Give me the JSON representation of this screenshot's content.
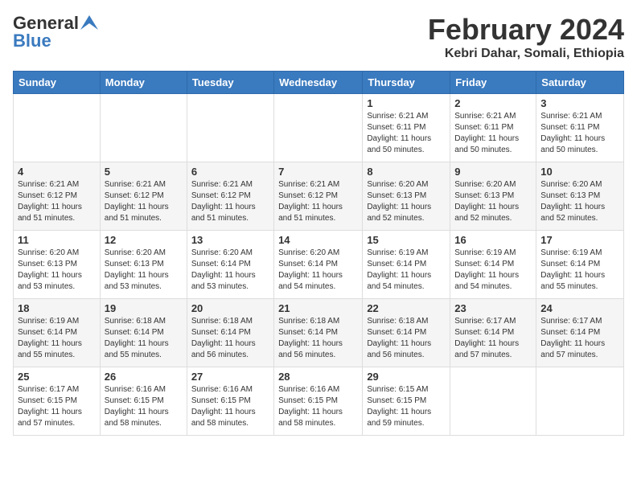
{
  "header": {
    "logo_general": "General",
    "logo_blue": "Blue",
    "month_title": "February 2024",
    "location": "Kebri Dahar, Somali, Ethiopia"
  },
  "weekdays": [
    "Sunday",
    "Monday",
    "Tuesday",
    "Wednesday",
    "Thursday",
    "Friday",
    "Saturday"
  ],
  "weeks": [
    [
      {
        "day": "",
        "info": ""
      },
      {
        "day": "",
        "info": ""
      },
      {
        "day": "",
        "info": ""
      },
      {
        "day": "",
        "info": ""
      },
      {
        "day": "1",
        "info": "Sunrise: 6:21 AM\nSunset: 6:11 PM\nDaylight: 11 hours\nand 50 minutes."
      },
      {
        "day": "2",
        "info": "Sunrise: 6:21 AM\nSunset: 6:11 PM\nDaylight: 11 hours\nand 50 minutes."
      },
      {
        "day": "3",
        "info": "Sunrise: 6:21 AM\nSunset: 6:11 PM\nDaylight: 11 hours\nand 50 minutes."
      }
    ],
    [
      {
        "day": "4",
        "info": "Sunrise: 6:21 AM\nSunset: 6:12 PM\nDaylight: 11 hours\nand 51 minutes."
      },
      {
        "day": "5",
        "info": "Sunrise: 6:21 AM\nSunset: 6:12 PM\nDaylight: 11 hours\nand 51 minutes."
      },
      {
        "day": "6",
        "info": "Sunrise: 6:21 AM\nSunset: 6:12 PM\nDaylight: 11 hours\nand 51 minutes."
      },
      {
        "day": "7",
        "info": "Sunrise: 6:21 AM\nSunset: 6:12 PM\nDaylight: 11 hours\nand 51 minutes."
      },
      {
        "day": "8",
        "info": "Sunrise: 6:20 AM\nSunset: 6:13 PM\nDaylight: 11 hours\nand 52 minutes."
      },
      {
        "day": "9",
        "info": "Sunrise: 6:20 AM\nSunset: 6:13 PM\nDaylight: 11 hours\nand 52 minutes."
      },
      {
        "day": "10",
        "info": "Sunrise: 6:20 AM\nSunset: 6:13 PM\nDaylight: 11 hours\nand 52 minutes."
      }
    ],
    [
      {
        "day": "11",
        "info": "Sunrise: 6:20 AM\nSunset: 6:13 PM\nDaylight: 11 hours\nand 53 minutes."
      },
      {
        "day": "12",
        "info": "Sunrise: 6:20 AM\nSunset: 6:13 PM\nDaylight: 11 hours\nand 53 minutes."
      },
      {
        "day": "13",
        "info": "Sunrise: 6:20 AM\nSunset: 6:14 PM\nDaylight: 11 hours\nand 53 minutes."
      },
      {
        "day": "14",
        "info": "Sunrise: 6:20 AM\nSunset: 6:14 PM\nDaylight: 11 hours\nand 54 minutes."
      },
      {
        "day": "15",
        "info": "Sunrise: 6:19 AM\nSunset: 6:14 PM\nDaylight: 11 hours\nand 54 minutes."
      },
      {
        "day": "16",
        "info": "Sunrise: 6:19 AM\nSunset: 6:14 PM\nDaylight: 11 hours\nand 54 minutes."
      },
      {
        "day": "17",
        "info": "Sunrise: 6:19 AM\nSunset: 6:14 PM\nDaylight: 11 hours\nand 55 minutes."
      }
    ],
    [
      {
        "day": "18",
        "info": "Sunrise: 6:19 AM\nSunset: 6:14 PM\nDaylight: 11 hours\nand 55 minutes."
      },
      {
        "day": "19",
        "info": "Sunrise: 6:18 AM\nSunset: 6:14 PM\nDaylight: 11 hours\nand 55 minutes."
      },
      {
        "day": "20",
        "info": "Sunrise: 6:18 AM\nSunset: 6:14 PM\nDaylight: 11 hours\nand 56 minutes."
      },
      {
        "day": "21",
        "info": "Sunrise: 6:18 AM\nSunset: 6:14 PM\nDaylight: 11 hours\nand 56 minutes."
      },
      {
        "day": "22",
        "info": "Sunrise: 6:18 AM\nSunset: 6:14 PM\nDaylight: 11 hours\nand 56 minutes."
      },
      {
        "day": "23",
        "info": "Sunrise: 6:17 AM\nSunset: 6:14 PM\nDaylight: 11 hours\nand 57 minutes."
      },
      {
        "day": "24",
        "info": "Sunrise: 6:17 AM\nSunset: 6:14 PM\nDaylight: 11 hours\nand 57 minutes."
      }
    ],
    [
      {
        "day": "25",
        "info": "Sunrise: 6:17 AM\nSunset: 6:15 PM\nDaylight: 11 hours\nand 57 minutes."
      },
      {
        "day": "26",
        "info": "Sunrise: 6:16 AM\nSunset: 6:15 PM\nDaylight: 11 hours\nand 58 minutes."
      },
      {
        "day": "27",
        "info": "Sunrise: 6:16 AM\nSunset: 6:15 PM\nDaylight: 11 hours\nand 58 minutes."
      },
      {
        "day": "28",
        "info": "Sunrise: 6:16 AM\nSunset: 6:15 PM\nDaylight: 11 hours\nand 58 minutes."
      },
      {
        "day": "29",
        "info": "Sunrise: 6:15 AM\nSunset: 6:15 PM\nDaylight: 11 hours\nand 59 minutes."
      },
      {
        "day": "",
        "info": ""
      },
      {
        "day": "",
        "info": ""
      }
    ]
  ]
}
